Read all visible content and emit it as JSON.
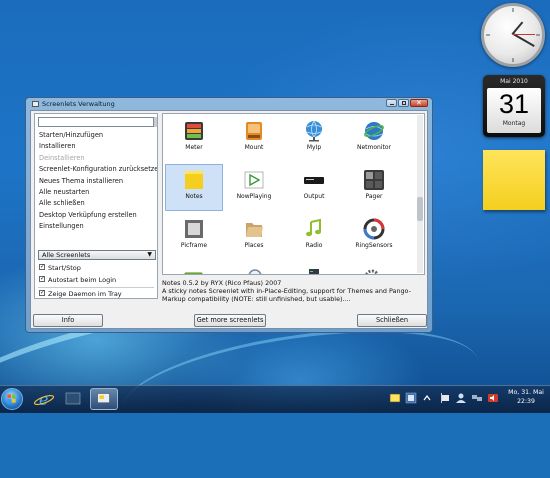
{
  "window": {
    "title": "Screenlets Verwaltung",
    "search_value": "",
    "menu": [
      {
        "label": "Starten/Hinzufügen",
        "disabled": false
      },
      {
        "label": "Installieren",
        "disabled": false
      },
      {
        "label": "Deinstallieren",
        "disabled": true
      },
      {
        "label": "Screenlet-Konfiguration zurücksetzen",
        "disabled": false
      },
      {
        "label": "Neues Thema installieren",
        "disabled": false
      },
      {
        "label": "Alle neustarten",
        "disabled": false
      },
      {
        "label": "Alle schließen",
        "disabled": false
      },
      {
        "label": "Desktop Verküpfung erstellen",
        "disabled": false
      },
      {
        "label": "Einstellungen",
        "disabled": false
      }
    ],
    "filter_select": "Alle Screenlets",
    "checkboxes": [
      {
        "label": "Start/Stop",
        "checked": true
      },
      {
        "label": "Autostart beim Login",
        "checked": true
      },
      {
        "label": "Zeige Daemon im Tray",
        "checked": true
      }
    ],
    "screenlets": [
      {
        "label": "Meter",
        "icon": "meter-icon",
        "selected": false
      },
      {
        "label": "Mount",
        "icon": "drive-icon",
        "selected": false
      },
      {
        "label": "MyIp",
        "icon": "globe-icon",
        "selected": false
      },
      {
        "label": "Netmonitor",
        "icon": "network-globe-icon",
        "selected": false
      },
      {
        "label": "Notes",
        "icon": "sticky-note-icon",
        "selected": true
      },
      {
        "label": "NowPlaying",
        "icon": "play-icon",
        "selected": false
      },
      {
        "label": "Output",
        "icon": "terminal-icon",
        "selected": false
      },
      {
        "label": "Pager",
        "icon": "workspace-pager-icon",
        "selected": false
      },
      {
        "label": "Picframe",
        "icon": "picture-frame-icon",
        "selected": false
      },
      {
        "label": "Places",
        "icon": "folder-icon",
        "selected": false
      },
      {
        "label": "Radio",
        "icon": "music-note-icon",
        "selected": false
      },
      {
        "label": "RingSensors",
        "icon": "ring-sensors-icon",
        "selected": false
      },
      {
        "label": "",
        "icon": "battery-icon",
        "selected": false
      },
      {
        "label": "",
        "icon": "magnifier-icon",
        "selected": false
      },
      {
        "label": "",
        "icon": "server-stack-icon",
        "selected": false
      },
      {
        "label": "",
        "icon": "gears-icon",
        "selected": false
      }
    ],
    "description": {
      "line1": "Notes 0.5.2 by RYX (Rico Pfaus) 2007",
      "line2": "A sticky notes Screenlet with in-Place-Editing, support for Themes and  Pango-",
      "line3": "Markup compatibility (NOTE: still unfinished, but usable)...."
    },
    "buttons": {
      "info": "Info",
      "more": "Get more screenlets",
      "close": "Schließen"
    }
  },
  "gadgets": {
    "calendar_month": "Mai 2010",
    "calendar_day": "31",
    "calendar_weekday": "Montag"
  },
  "taskbar": {
    "date_line": "Mo, 31. Mai",
    "time_line": "22:39"
  },
  "colors": {
    "desktop": "#1b6cbd",
    "window_frame": "#8fb8dd",
    "selection": "#cfe1f6",
    "note_yellow": "#f4cf1f"
  }
}
